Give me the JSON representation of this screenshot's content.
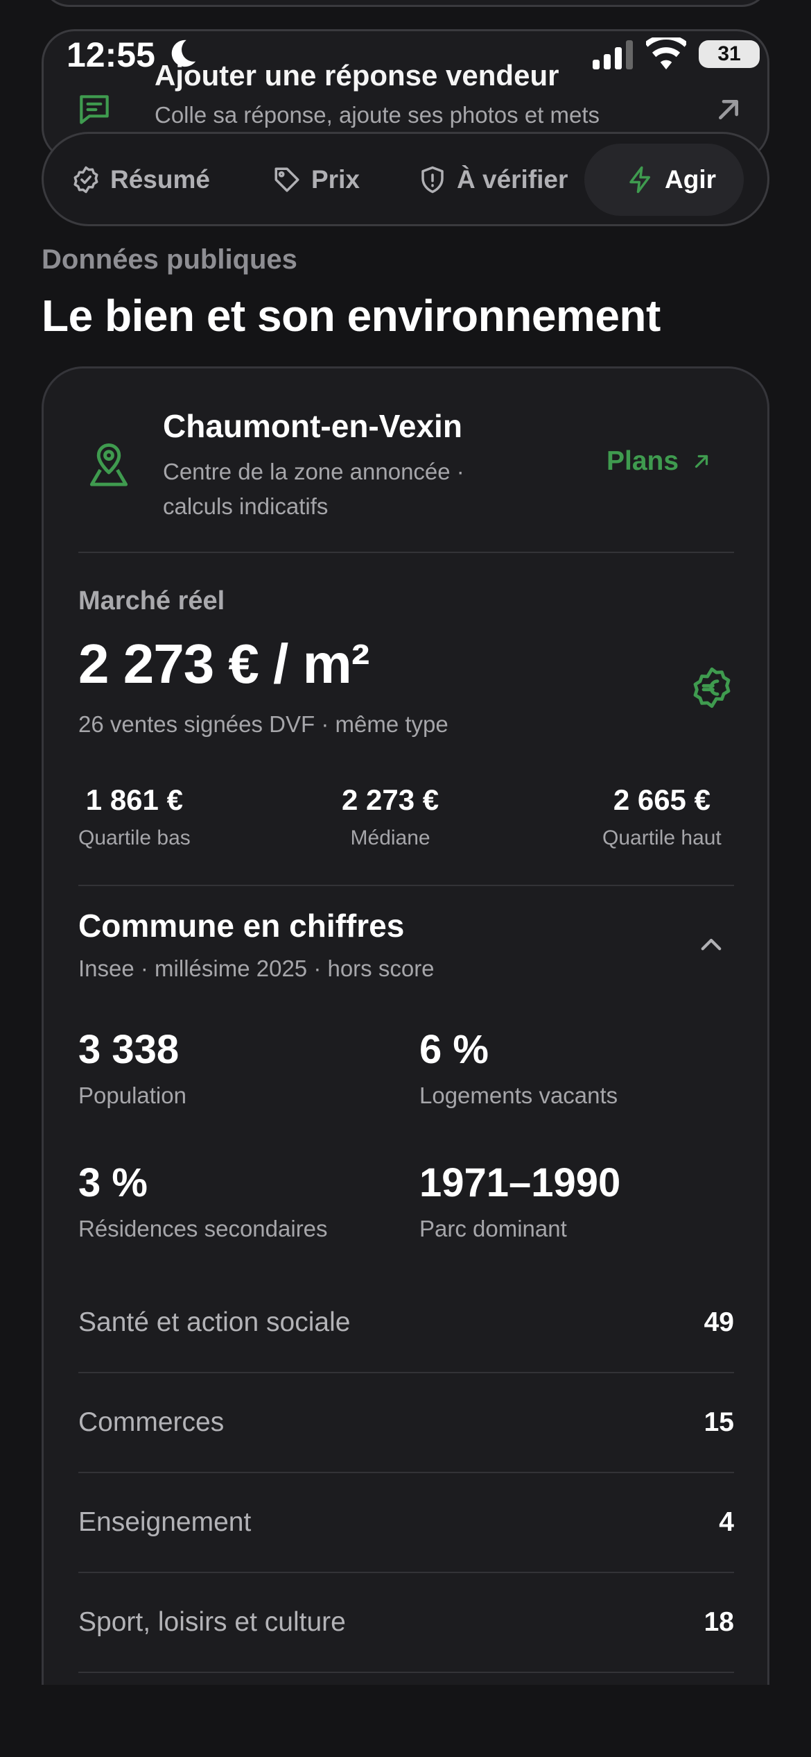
{
  "status_bar": {
    "time": "12:55",
    "battery": "31"
  },
  "vendor_card": {
    "title": "Ajouter une réponse vendeur",
    "subtitle": "Colle sa réponse, ajoute ses photos et mets"
  },
  "tabs": [
    {
      "label": "Résumé",
      "icon": "check-badge-icon"
    },
    {
      "label": "Prix",
      "icon": "tag-icon"
    },
    {
      "label": "À vérifier",
      "icon": "shield-alert-icon"
    },
    {
      "label": "Agir",
      "icon": "lightning-icon",
      "active": true
    }
  ],
  "section": {
    "overline": "Données publiques",
    "title": "Le bien et son environnement"
  },
  "location": {
    "name": "Chaumont-en-Vexin",
    "subtitle": "Centre de la zone annoncée · calculs indicatifs",
    "link": "Plans"
  },
  "market": {
    "label": "Marché réel",
    "value": "2 273 € / m²",
    "subtitle": "26 ventes signées DVF · même type",
    "quartiles": [
      {
        "value": "1 861 €",
        "label": "Quartile bas"
      },
      {
        "value": "2 273 €",
        "label": "Médiane"
      },
      {
        "value": "2 665 €",
        "label": "Quartile haut"
      }
    ]
  },
  "commune": {
    "title": "Commune en chiffres",
    "subtitle": "Insee · millésime 2025 · hors score",
    "stats": [
      {
        "value": "3 338",
        "label": "Population"
      },
      {
        "value": "6 %",
        "label": "Logements vacants"
      },
      {
        "value": "3 %",
        "label": "Résidences secondaires"
      },
      {
        "value": "1971–1990",
        "label": "Parc dominant"
      }
    ],
    "rows": [
      {
        "label": "Santé et action sociale",
        "value": "49"
      },
      {
        "label": "Commerces",
        "value": "15"
      },
      {
        "label": "Enseignement",
        "value": "4"
      },
      {
        "label": "Sport, loisirs et culture",
        "value": "18"
      }
    ]
  },
  "colors": {
    "accent": "#3f9b4f",
    "background": "#141416",
    "card": "#1c1c1f"
  }
}
